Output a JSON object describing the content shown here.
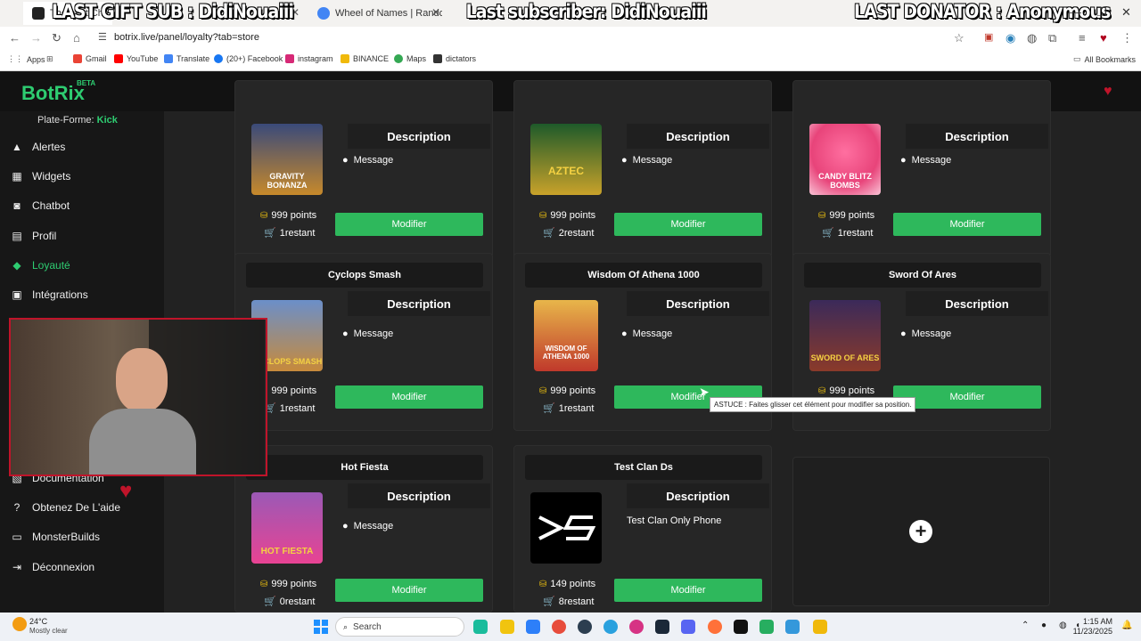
{
  "browser": {
    "tabs": [
      {
        "label": "The best Cha"
      },
      {
        "label": "Wheel of Names | Random nam"
      }
    ],
    "overlay": {
      "gift": "LAST GIFT SUB : DidiNouaiii",
      "subscriber": "Last subscriber: DidiNouaiii",
      "donator": "LAST DONATOR : Anonymous"
    },
    "url": "botrix.live/panel/loyalty?tab=store",
    "bookmarks": [
      "Apps",
      "Gmail",
      "YouTube",
      "Translate",
      "(20+) Facebook",
      "instagram",
      "BINANCE",
      "Maps",
      "dictators"
    ],
    "all_bookmarks": "All Bookmarks"
  },
  "app": {
    "logo": "BotRix",
    "beta": "BETA",
    "platform_label": "Plate-Forme:",
    "platform_value": "Kick"
  },
  "sidebar": {
    "items": [
      {
        "label": "Alertes",
        "icon": "bell-icon"
      },
      {
        "label": "Widgets",
        "icon": "table-icon"
      },
      {
        "label": "Chatbot",
        "icon": "robot-icon"
      },
      {
        "label": "Profil",
        "icon": "profile-icon"
      },
      {
        "label": "Loyauté",
        "icon": "gem-icon",
        "active": true
      },
      {
        "label": "Intégrations",
        "icon": "plug-icon"
      },
      {
        "label": "Documentation",
        "icon": "doc-icon"
      },
      {
        "label": "Obtenez De L'aide",
        "icon": "help-icon"
      },
      {
        "label": "MonsterBuilds",
        "icon": "monitor-icon"
      },
      {
        "label": "Déconnexion",
        "icon": "logout-icon"
      }
    ]
  },
  "cards": [
    {
      "title": "",
      "desc": "Description",
      "msg": "Message",
      "points": "999 points",
      "remaining": "1restant",
      "button": "Modifier",
      "art": "GRAVITY BONANZA",
      "color": "#c7892b"
    },
    {
      "title": "",
      "desc": "Description",
      "msg": "Message",
      "points": "999 points",
      "remaining": "2restant",
      "button": "Modifier",
      "art": "AZTEC",
      "color": "#2a8a3a"
    },
    {
      "title": "",
      "desc": "Description",
      "msg": "Message",
      "points": "999 points",
      "remaining": "1restant",
      "button": "Modifier",
      "art": "CANDY BLITZ BOMBS",
      "color": "#e8447a"
    },
    {
      "title": "Cyclops Smash",
      "desc": "Description",
      "msg": "Message",
      "points": "999 points",
      "remaining": "1restant",
      "button": "Modifier",
      "art": "CYCLOPS SMASH",
      "color": "#3b6ea8"
    },
    {
      "title": "Wisdom Of Athena 1000",
      "desc": "Description",
      "msg": "Message",
      "points": "999 points",
      "remaining": "1restant",
      "button": "Modifier",
      "art": "WISDOM OF ATHENA 1000",
      "color": "#c0392b"
    },
    {
      "title": "Sword Of Ares",
      "desc": "Description",
      "msg": "Message",
      "points": "999 points",
      "remaining": "",
      "button": "Modifier",
      "art": "SWORD OF ARES",
      "color": "#6a2c8a"
    },
    {
      "title": "Hot Fiesta",
      "desc": "Description",
      "msg": "Message",
      "points": "999 points",
      "remaining": "0restant",
      "button": "Modifier",
      "art": "HOT FIESTA",
      "color": "#8e44ad"
    },
    {
      "title": "Test Clan Ds",
      "desc": "Description",
      "msg": "",
      "msgtext": "Test Clan Only Phone",
      "points": "149 points",
      "remaining": "8restant",
      "button": "Modifier",
      "art": "",
      "color": "#000000"
    }
  ],
  "tooltip": "ASTUCE : Faites glisser cet élément pour modifier sa position.",
  "taskbar": {
    "temp": "24°C",
    "weather": "Mostly clear",
    "search": "Search",
    "time": "1:15 AM",
    "date": "11/23/2025"
  }
}
